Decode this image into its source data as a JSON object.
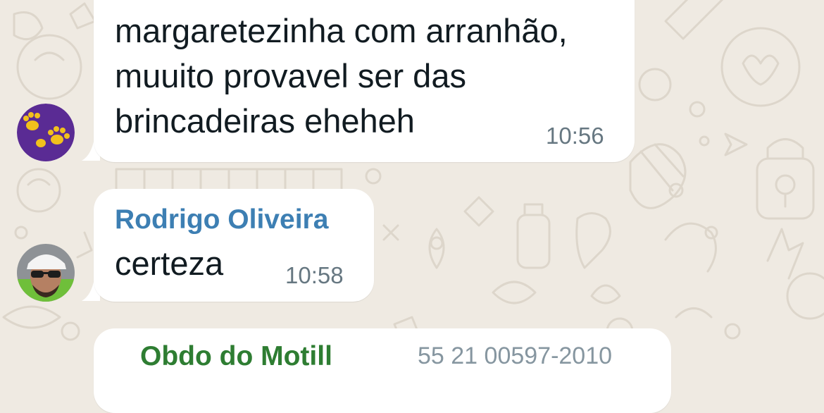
{
  "colors": {
    "background": "#efeae2",
    "bubble": "#ffffff",
    "text": "#111b21",
    "time": "#667781",
    "sender_rodrigo": "#3d7fb3",
    "sender_third": "#2e7d32",
    "avatar_paw_bg": "#5a2b94",
    "avatar_paw": "#f2c11c"
  },
  "messages": [
    {
      "sender": "",
      "avatar": "paw-print-avatar",
      "text": "margaretezinha com arranhão,\nmuuito provavel ser das\nbrincadeiras eheheh",
      "time": "10:56"
    },
    {
      "sender": "Rodrigo Oliveira",
      "avatar": "man-sunglasses-photo-avatar",
      "text": "certeza",
      "time": "10:58"
    },
    {
      "sender": "Obdo do Motill",
      "sender_phone": "55 21 00597-2010"
    }
  ]
}
